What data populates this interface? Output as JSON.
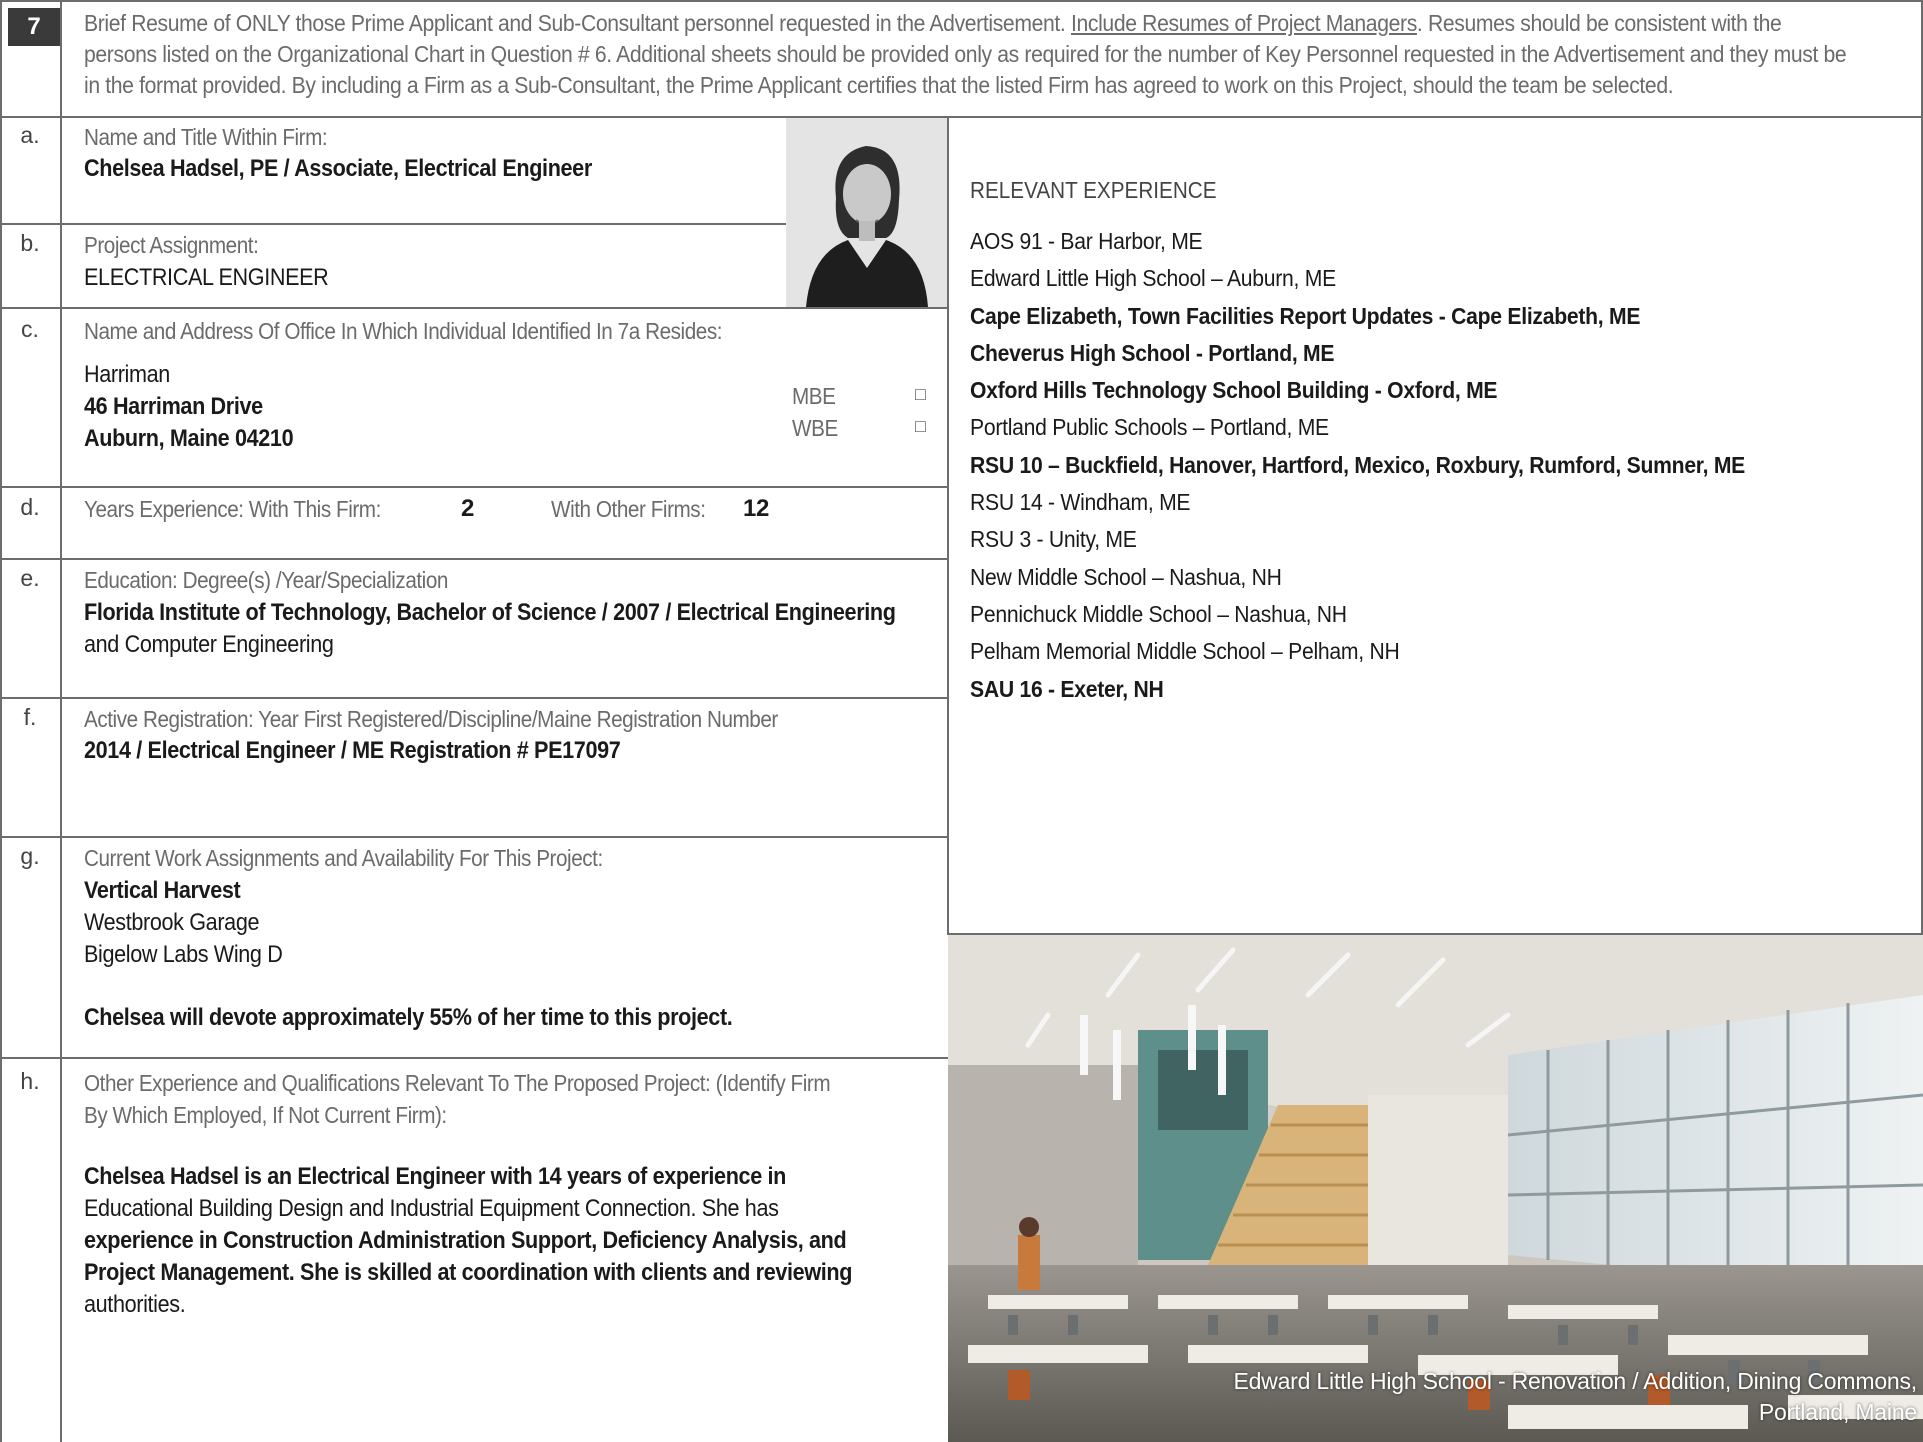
{
  "header": {
    "number": "7",
    "intro_part1": "Brief Resume of ONLY those Prime Applicant and Sub-Consultant personnel requested in the Advertisement. ",
    "intro_link": "Include Resumes of Project Managers",
    "intro_part2": ". Resumes should be consistent with the persons listed on the Organizational Chart in Question # 6. Additional sheets should be provided only as required for the number of Key Personnel requested in the Advertisement and they must be in the format provided. By including a Firm as a Sub-Consultant, the Prime Applicant certifies that the listed Firm has agreed to work on this Project, should the team be selected."
  },
  "rows": {
    "a": {
      "letter": "a.",
      "label": "Name and Title Within Firm:",
      "value": "Chelsea Hadsel, PE / Associate, Electrical Engineer"
    },
    "b": {
      "letter": "b.",
      "label": "Project Assignment:",
      "value": "ELECTRICAL ENGINEER"
    },
    "c": {
      "letter": "c.",
      "label": "Name and Address Of Office In Which Individual Identified In 7a Resides:",
      "line1": "Harriman",
      "line2": "46 Harriman Drive",
      "line3": "Auburn, Maine 04210",
      "mbe": "MBE",
      "wbe": "WBE",
      "checkbox": "□"
    },
    "d": {
      "letter": "d.",
      "label1": "Years Experience:  With This Firm:",
      "value1": "2",
      "label2": "With Other Firms:",
      "value2": "12"
    },
    "e": {
      "letter": "e.",
      "label": "Education:  Degree(s) /Year/Specialization",
      "value_bold": "Florida Institute of Technology, Bachelor of Science / 2007 / Electrical Engineering",
      "value_regular": "and Computer Engineering"
    },
    "f": {
      "letter": "f.",
      "label": "Active Registration:  Year First Registered/Discipline/Maine Registration Number",
      "value": "2014 / Electrical Engineer / ME Registration # PE17097"
    },
    "g": {
      "letter": "g.",
      "label": "Current Work Assignments and Availability For This Project:",
      "item1": "Vertical Harvest",
      "item2": "Westbrook Garage",
      "item3": "Bigelow Labs Wing D",
      "availability": "Chelsea will devote approximately 55% of her time to this project."
    },
    "h": {
      "letter": "h.",
      "label_line1": "Other Experience and Qualifications Relevant To The Proposed Project: (Identify Firm",
      "label_line2": "By Which Employed, If Not Current Firm):",
      "p1_bold": "Chelsea Hadsel is an Electrical Engineer with 14 years of experience in",
      "p2_regular": "Educational Building Design and Industrial Equipment Connection. She has",
      "p3_bold": "experience in Construction Administration Support, Deficiency Analysis, and",
      "p4_bold": "Project Management. She is skilled at coordination with clients and reviewing",
      "p5_regular": "authorities."
    }
  },
  "experience": {
    "heading": "RELEVANT EXPERIENCE",
    "items": [
      {
        "text": "AOS 91 - Bar Harbor, ME",
        "bold": false
      },
      {
        "text": "Edward Little High School – Auburn, ME",
        "bold": false
      },
      {
        "text": "Cape Elizabeth, Town Facilities Report Updates - Cape Elizabeth, ME",
        "bold": true
      },
      {
        "text": "Cheverus High School - Portland, ME",
        "bold": true
      },
      {
        "text": "Oxford Hills Technology School Building - Oxford, ME",
        "bold": true
      },
      {
        "text": "Portland Public Schools – Portland, ME",
        "bold": false
      },
      {
        "text": "RSU 10 – Buckfield, Hanover, Hartford, Mexico, Roxbury, Rumford, Sumner, ME",
        "bold": true
      },
      {
        "text": "RSU 14 - Windham, ME",
        "bold": false
      },
      {
        "text": "RSU 3 - Unity, ME",
        "bold": false
      },
      {
        "text": "New Middle School – Nashua, NH",
        "bold": false
      },
      {
        "text": "Pennichuck Middle School – Nashua, NH",
        "bold": false
      },
      {
        "text": "Pelham Memorial Middle School – Pelham, NH",
        "bold": false
      },
      {
        "text": "SAU 16 - Exeter, NH",
        "bold": true
      }
    ]
  },
  "photo": {
    "caption_line1": "Edward Little High School - Renovation / Addition, Dining Commons,",
    "caption_line2": "Portland, Maine"
  }
}
